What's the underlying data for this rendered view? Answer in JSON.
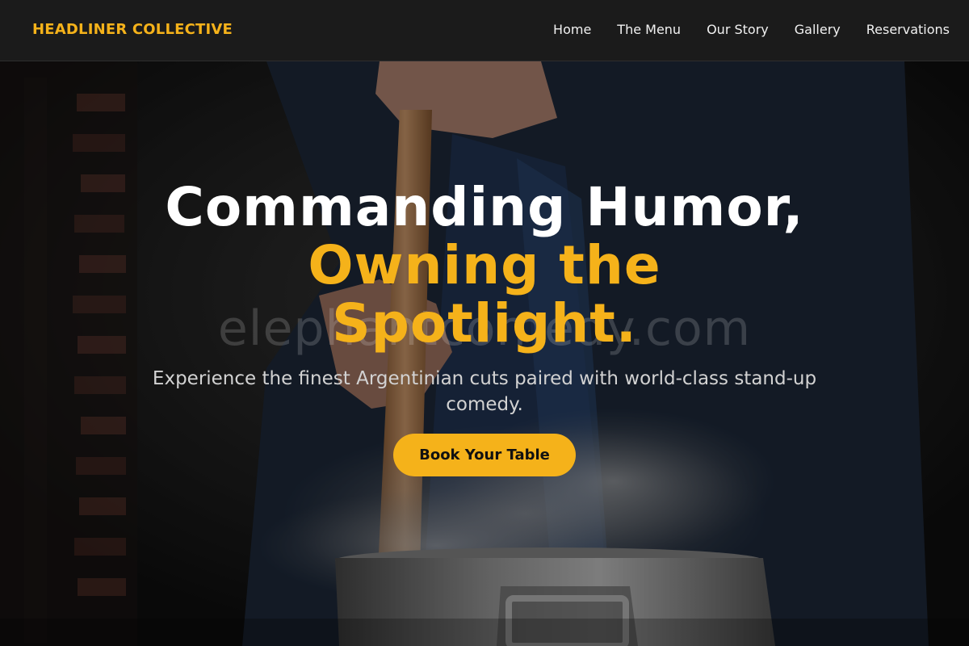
{
  "brand": {
    "name": "HEADLINER COLLECTIVE"
  },
  "nav": {
    "links": [
      "Home",
      "The Menu",
      "Our Story",
      "Gallery",
      "Reservations"
    ]
  },
  "hero": {
    "title_line1": "Commanding Humor,",
    "title_accent": "Owning the Spotlight.",
    "subtitle": "Experience the finest Argentinian cuts paired with world-class stand-up comedy.",
    "cta_label": "Book Your Table",
    "watermark": "elephantcomedy.com"
  },
  "colors": {
    "accent": "#f5b21a",
    "nav_background": "#1b1b1b",
    "text_primary": "#ffffff",
    "text_muted": "#d2d2d2"
  }
}
